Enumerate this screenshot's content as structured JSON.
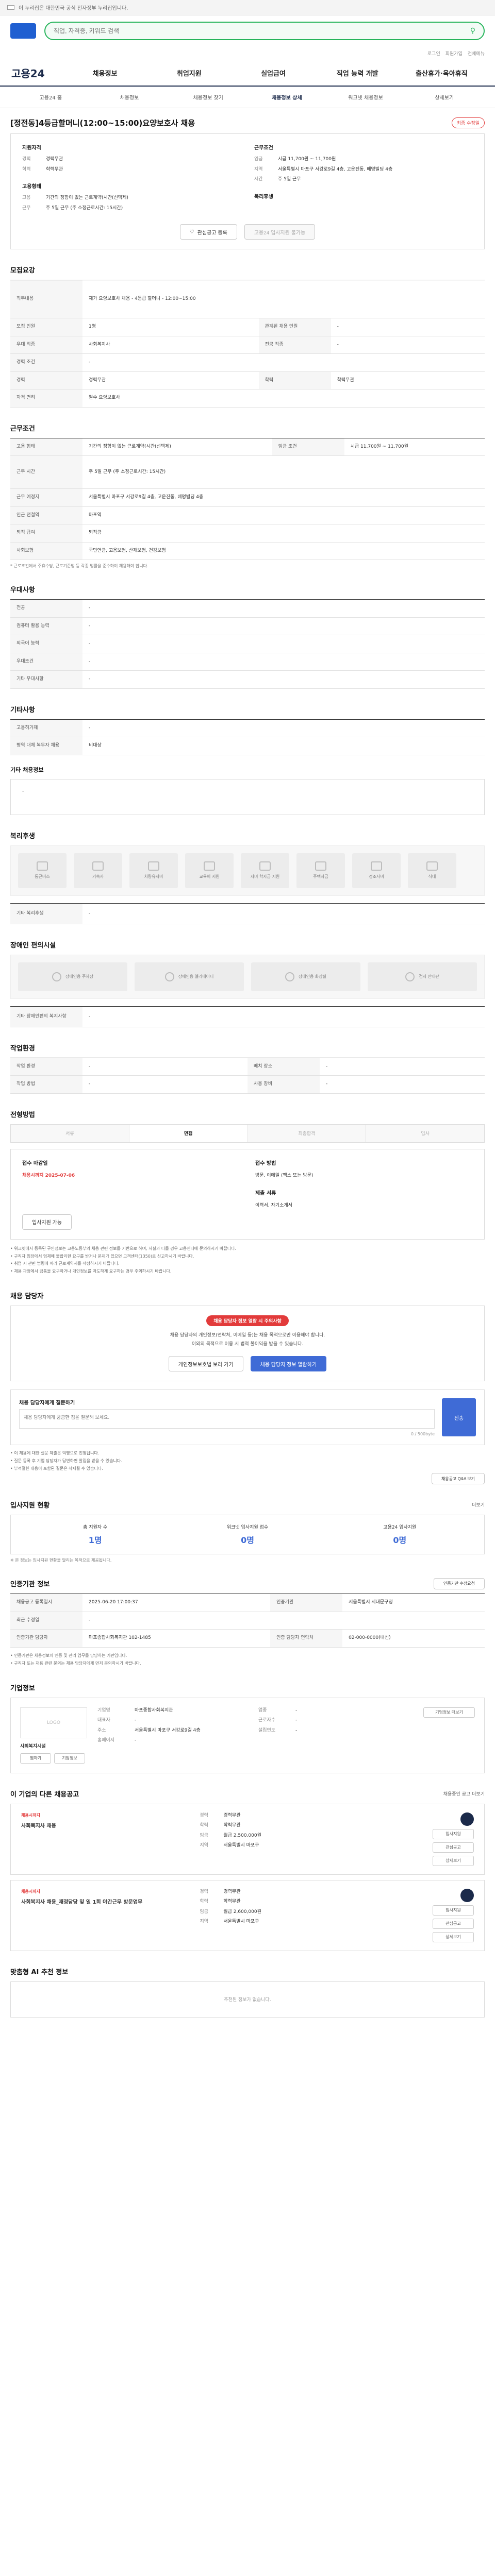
{
  "topbar": {
    "notice": "이 누리집은 대한민국 공식 전자정부 누리집입니다."
  },
  "search": {
    "placeholder": "직업, 자격증, 키워드 검색"
  },
  "util": {
    "login": "로그인",
    "join": "회원가입",
    "sitemap": "전체메뉴"
  },
  "gnb": {
    "home": "고용24",
    "items": [
      "채용정보",
      "취업지원",
      "실업급여",
      "직업 능력 개발",
      "출산휴가·육아휴직"
    ]
  },
  "subnav": {
    "items": [
      "고용24 홈",
      "채용정보",
      "채용정보 찾기",
      "채용정보 상세",
      "워크넷 채용정보",
      "상세보기"
    ],
    "active": 3
  },
  "job": {
    "title": "[정전동]4등급할머니(12:00~15:00)요양보호사 채용",
    "badge": "최종 수정일",
    "summary_left_title": "지원자격",
    "summary_right_title": "근무조건",
    "left": [
      {
        "k": "경력",
        "v": "경력무관"
      },
      {
        "k": "학력",
        "v": "학력무관"
      }
    ],
    "right": [
      {
        "k": "임금",
        "v": "시급 11,700원 ~ 11,700원"
      },
      {
        "k": "지역",
        "v": "서울특별시 마포구 서강로9길 4층, 고운진동, 배명빌딩 4층"
      },
      {
        "k": "시간",
        "v": "주 5일 근무"
      }
    ],
    "left2_title": "고용형태",
    "left2": [
      {
        "k": "고용",
        "v": "기간의 정함이 없는 근로계약(시간(선택제)"
      },
      {
        "k": "근무",
        "v": "주 5일 근무 (주 소정근로시간: 15시간)"
      }
    ],
    "right2_title": "복리후생",
    "buttons": {
      "scrap": "관심공고 등록",
      "apply": "고용24 입사지원 불가능"
    }
  },
  "detail": {
    "title": "모집요강",
    "rows": [
      {
        "k": "직무내용",
        "v": "재가 요양보호사 채용 - 4등급 할머니 - 12:00~15:00"
      },
      {
        "k": "모집 인원",
        "v": "1명"
      },
      {
        "k": "우대 직종",
        "v": "사회복지사"
      },
      {
        "k": "경력 조건",
        "v": "-"
      },
      {
        "k": "경력",
        "v": "경력무관"
      },
      {
        "k": "학력",
        "v": "학력무관"
      },
      {
        "k": "자격 면허",
        "v": "필수 요양보호사"
      }
    ],
    "right_rows": [
      {
        "k": "관계된 채용 인원",
        "v": "-"
      },
      {
        "k": "전공 직종",
        "v": "-"
      }
    ]
  },
  "work": {
    "title": "근무조건",
    "rows": [
      {
        "k": "고용 형태",
        "v": "기간의 정함이 없는 근로계약(시간(선택제)"
      },
      {
        "k": "근무 시간",
        "v": "주 5일 근무 (주 소정근로시간: 15시간)"
      },
      {
        "k": "근무 예정지",
        "v": "서울특별시 마포구 서강로9길 4층, 고운진동, 배명빌딩 4층"
      },
      {
        "k": "인근 전철역",
        "v": "마포역"
      },
      {
        "k": "퇴직 급여",
        "v": "퇴직금"
      },
      {
        "k": "사회보험",
        "v": "국민연금, 고용보험, 산재보험, 건강보험"
      }
    ],
    "pay_label": "임금 조건",
    "pay": "시급 11,700원 ~ 11,700원",
    "note": "* 근로조건에서 주휴수당, 근로기준법 등 각종 법률을 준수하여 채용해야 합니다."
  },
  "prefer": {
    "title": "우대사항",
    "rows": [
      {
        "k": "전공",
        "v": "-"
      },
      {
        "k": "컴퓨터 활용 능력",
        "v": "-"
      },
      {
        "k": "외국어 능력",
        "v": "-"
      },
      {
        "k": "우대조건",
        "v": "-"
      },
      {
        "k": "기타 우대사항",
        "v": "-"
      }
    ]
  },
  "etc": {
    "title": "기타사항",
    "rows": [
      {
        "k": "고용허가제",
        "v": "-"
      },
      {
        "k": "병역 대체 복무자 채용",
        "v": "비대상"
      }
    ],
    "extra_title": "기타 채용정보",
    "extra": "-"
  },
  "welfare": {
    "title": "복리후생",
    "tiles": [
      "통근버스",
      "기숙사",
      "차량유지비",
      "교육비 지원",
      "자녀 학자금 지원",
      "주택자금",
      "경조사비",
      "식대"
    ],
    "etc_label": "기타 복리후생",
    "etc_value": "-"
  },
  "facility": {
    "title": "장애인 편의시설",
    "tiles": [
      "장애인용 주차장",
      "장애인용 엘리베이터",
      "장애인용 화장실",
      "점자 안내판"
    ],
    "etc_label": "기타 장애인편의 복지사항",
    "etc_value": "-"
  },
  "env": {
    "title": "작업환경",
    "rows": [
      {
        "k": "작업 환경",
        "v": "-"
      },
      {
        "k": "작업 방법",
        "v": "-"
      }
    ],
    "right_rows": [
      {
        "k": "배치 장소",
        "v": "-"
      },
      {
        "k": "사용 장비",
        "v": "-"
      }
    ]
  },
  "process": {
    "title": "전형방법",
    "steps": [
      "서류",
      "면접",
      "최종합격",
      "입사"
    ],
    "active": 1,
    "rows": [
      {
        "k": "접수 마감일",
        "v": "채용시까지 2025-07-06"
      },
      {
        "k": "접수 방법",
        "v": "방문, 이메일 (팩스 또는 방문)"
      },
      {
        "k": "제출 서류",
        "v": "이력서, 자기소개서"
      }
    ],
    "apply_btn": "입사지원 가능",
    "bullets": [
      "• 워크넷에서 등록된 구인정보는 고용노동부의 채용 관련 정보를 기반으로 하며, 사실과 다를 경우 고용센터에 문의하시기 바랍니다.",
      "• 구직자 입장에서 업체에 불합리한 요구를 받거나 문제가 있으면 고객센터(1350)로 신고하시기 바랍니다.",
      "• 취업 시 관련 법령에 따라 근로계약서를 작성하시기 바랍니다.",
      "• 채용 과정에서 금품을 요구하거나 개인정보를 과도하게 요구하는 경우 주의하시기 바랍니다."
    ]
  },
  "contact": {
    "title": "채용 담당자",
    "pill": "채용 담당자 정보 열람 시 주의사항",
    "msg1": "채용 담당자의 개인정보(연락처, 이메일 등)는 채용 목적으로만 이용해야 합니다.",
    "msg2": "이외의 목적으로 이용 시 법적 불이익을 받을 수 있습니다.",
    "btn1": "개인정보보호법 보러 가기",
    "btn2": "채용 담당자 정보 열람하기",
    "qa_label": "채용 담당자에게 질문하기",
    "qa_placeholder": "채용 담당자에게 궁금한 점을 질문해 보세요.",
    "qa_count": "0 / 500byte",
    "qa_btn": "전송",
    "notes": [
      "• 이 채용에 대한 질문 제출은 익명으로 진행됩니다.",
      "• 질문 등록 후 기업 담당자가 답변하면 알림을 받을 수 있습니다.",
      "• 부적절한 내용이 포함된 질문은 삭제될 수 있습니다."
    ],
    "more": "채용공고 Q&A 보기"
  },
  "stats": {
    "title": "입사지원 현황",
    "link": "더보기",
    "items": [
      {
        "label": "총 지원자 수",
        "value": "1명"
      },
      {
        "label": "워크넷 입사지원 접수",
        "value": "0명"
      },
      {
        "label": "고용24 입사지원",
        "value": "0명"
      }
    ],
    "note": "※ 본 정보는 입사지원 현황을 알리는 목적으로 제공됩니다."
  },
  "info": {
    "title": "인증기관 정보",
    "link": "인증기관 수정요청",
    "rows": [
      {
        "k": "채용공고 등록일시",
        "v": "2025-06-20 17:00:37",
        "k2": "인증기관",
        "v2": "서울특별시 서대문구청",
        "k3": "최근 수정일",
        "v3": "-"
      },
      {
        "k": "인증기관 담당자",
        "v": "마포종합사회복지관 102-1485",
        "k2": "인증 담당자 연락처",
        "v2": "02-000-0000(내선)"
      }
    ],
    "bullets": [
      "• 인증기관은 채용정보의 인증 및 관리 업무를 담당하는 기관입니다.",
      "• 구직자 또는 채용 관련 문의는 채용 담당자에게 먼저 문의하시기 바랍니다."
    ]
  },
  "company": {
    "title": "기업정보",
    "logo": "LOGO",
    "name": "사회복지시설",
    "btn1": "찜하기",
    "btn2": "기업정보",
    "rows": [
      {
        "k": "기업명",
        "v": "마포종합사회복지관",
        "k2": "업종",
        "v2": "-"
      },
      {
        "k": "대표자",
        "v": "-",
        "k2": "근로자수",
        "v2": "-"
      },
      {
        "k": "주소",
        "v": "서울특별시 마포구 서강로9길 4층",
        "k2": "설립연도",
        "v2": "-"
      },
      {
        "k": "홈페이지",
        "v": "-",
        "k2": "",
        "v2": ""
      }
    ],
    "more": "기업정보 더보기"
  },
  "related": {
    "title": "이 기업의 다른 채용공고",
    "link": "채용중인 공고 더보기",
    "items": [
      {
        "tag": "채용시까지",
        "name": "사회복지사 채용",
        "meta": [
          {
            "k": "경력",
            "v": "경력무관"
          },
          {
            "k": "학력",
            "v": "학력무관"
          },
          {
            "k": "임금",
            "v": "월급 2,500,000원"
          },
          {
            "k": "지역",
            "v": "서울특별시 마포구"
          }
        ],
        "btns": [
          "입사지원",
          "관심공고",
          "상세보기"
        ]
      },
      {
        "tag": "채용시까지",
        "name": "사회복지사 채용_재정담당 및 일 1회 야간근무 방문업무",
        "meta": [
          {
            "k": "경력",
            "v": "경력무관"
          },
          {
            "k": "학력",
            "v": "학력무관"
          },
          {
            "k": "임금",
            "v": "월급 2,600,000원"
          },
          {
            "k": "지역",
            "v": "서울특별시 마포구"
          }
        ],
        "btns": [
          "입사지원",
          "관심공고",
          "상세보기"
        ]
      }
    ]
  },
  "recommend": {
    "title": "맞춤형 AI 추천 정보",
    "empty": "추천된 정보가 없습니다."
  }
}
